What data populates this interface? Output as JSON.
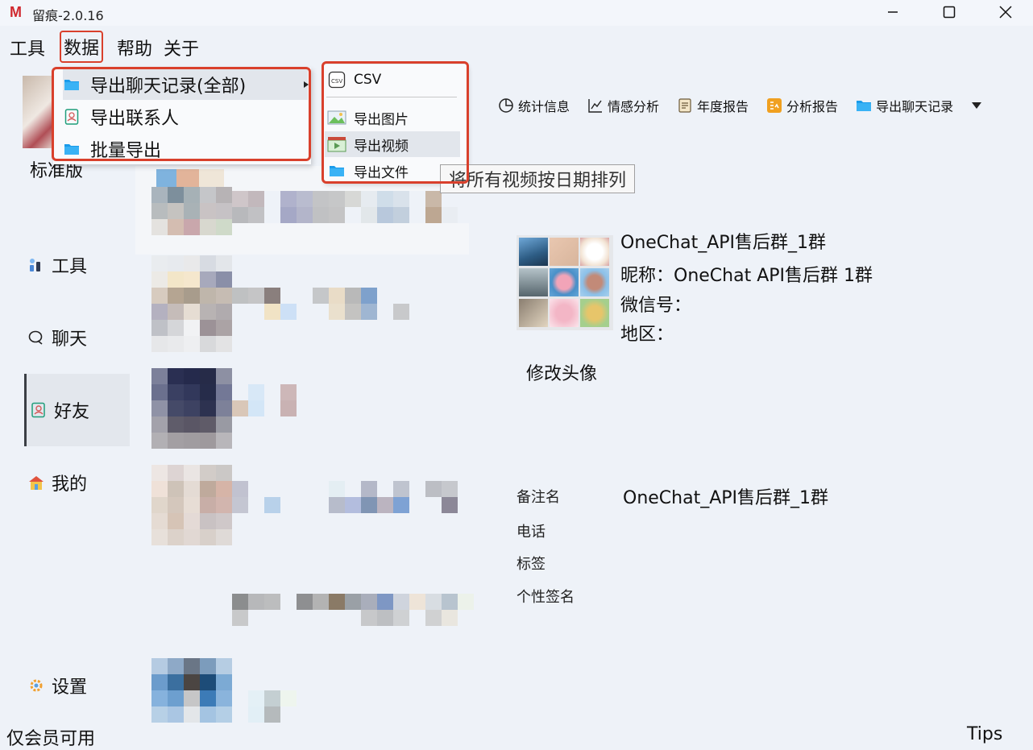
{
  "app": {
    "logo": "M",
    "title": "留痕-2.0.16"
  },
  "menubar": {
    "tools": "工具",
    "data": "数据",
    "help": "帮助",
    "about": "关于"
  },
  "data_menu": {
    "items": [
      {
        "label": "导出聊天记录(全部)",
        "icon": "folder-icon",
        "has_submenu": true
      },
      {
        "label": "导出联系人",
        "icon": "contacts-icon"
      },
      {
        "label": "批量导出",
        "icon": "folder-icon"
      }
    ]
  },
  "export_submenu": {
    "items": [
      {
        "label": "CSV",
        "icon": "csv-file-icon"
      },
      {
        "label": "导出图片",
        "icon": "image-icon"
      },
      {
        "label": "导出视频",
        "icon": "video-icon"
      },
      {
        "label": "导出文件",
        "icon": "folder-icon"
      }
    ],
    "tooltip": "将所有视频按日期排列"
  },
  "sidebar": {
    "edition": "标准版",
    "items": [
      {
        "label": "工具",
        "icon": "tools-icon"
      },
      {
        "label": "聊天",
        "icon": "chat-icon"
      },
      {
        "label": "好友",
        "icon": "contacts-icon",
        "active": true
      },
      {
        "label": "我的",
        "icon": "home-icon"
      },
      {
        "label": "设置",
        "icon": "gear-icon"
      }
    ]
  },
  "toolbar": {
    "items": [
      {
        "label": "统计信息",
        "icon": "pie-chart-icon"
      },
      {
        "label": "情感分析",
        "icon": "bar-chart-icon"
      },
      {
        "label": "年度报告",
        "icon": "report-icon"
      },
      {
        "label": "分析报告",
        "icon": "analysis-icon"
      },
      {
        "label": "导出聊天记录",
        "icon": "folder-icon"
      }
    ]
  },
  "detail": {
    "name": "OneChat_API售后群_1群",
    "nickname": "昵称：OneChat API售后群 1群",
    "wechat_id": "微信号：",
    "region": "地区：",
    "change_avatar": "修改头像",
    "fields": {
      "remark_label": "备注名",
      "remark_value": "OneChat_API售后群_1群",
      "phone_label": "电话",
      "tags_label": "标签",
      "signature_label": "个性签名"
    }
  },
  "status": {
    "left": "仅会员可用",
    "right": "Tips"
  },
  "colors": {
    "background": "#eef2f8",
    "highlight_box": "#d9402c",
    "brand": "#d0282e"
  }
}
